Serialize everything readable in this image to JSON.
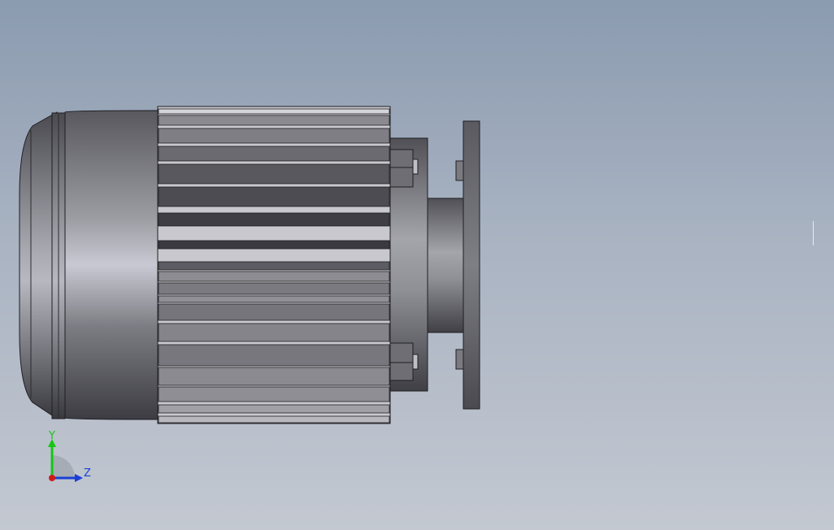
{
  "viewport": {
    "background_top": "#8b9bb0",
    "background_bottom": "#c3c8d1"
  },
  "model": {
    "description_icon": "electric-motor-side-view",
    "body_color": "#8a8a90",
    "fin_dark": "#46464c",
    "fin_light": "#a7a7ad"
  },
  "triad": {
    "y_label": "Y",
    "z_label": "Z",
    "y_color": "#16c516",
    "z_color": "#1a3fd6",
    "x_color": "#d11a1a"
  }
}
